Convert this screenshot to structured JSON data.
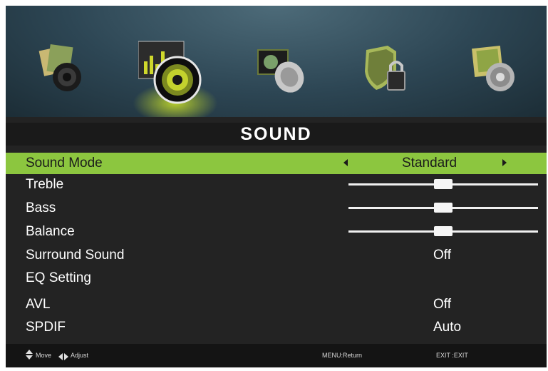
{
  "menu": {
    "title": "SOUND",
    "icons": [
      {
        "name": "picture-menu-icon",
        "selected": false
      },
      {
        "name": "sound-menu-icon",
        "selected": true
      },
      {
        "name": "channel-menu-icon",
        "selected": false
      },
      {
        "name": "lock-menu-icon",
        "selected": false
      },
      {
        "name": "setup-menu-icon",
        "selected": false
      }
    ]
  },
  "items": [
    {
      "label": "Sound Mode",
      "value": "Standard",
      "type": "selector",
      "selected": true
    },
    {
      "label": "Treble",
      "type": "slider",
      "level": 0.5
    },
    {
      "label": "Bass",
      "type": "slider",
      "level": 0.5
    },
    {
      "label": "Balance",
      "type": "slider",
      "level": 0.5
    },
    {
      "label": "Surround Sound",
      "value": "Off",
      "type": "value"
    },
    {
      "label": "EQ Setting",
      "value": "",
      "type": "submenu"
    },
    {
      "label": "AVL",
      "value": "Off",
      "type": "value"
    },
    {
      "label": "SPDIF",
      "value": "Auto",
      "type": "value"
    }
  ],
  "footer": {
    "move": "Move",
    "adjust": "Adjust",
    "menu_return": "MENU:Return",
    "exit": "EXIT :EXIT"
  },
  "colors": {
    "highlight": "#8cc63f",
    "background": "#232323"
  }
}
